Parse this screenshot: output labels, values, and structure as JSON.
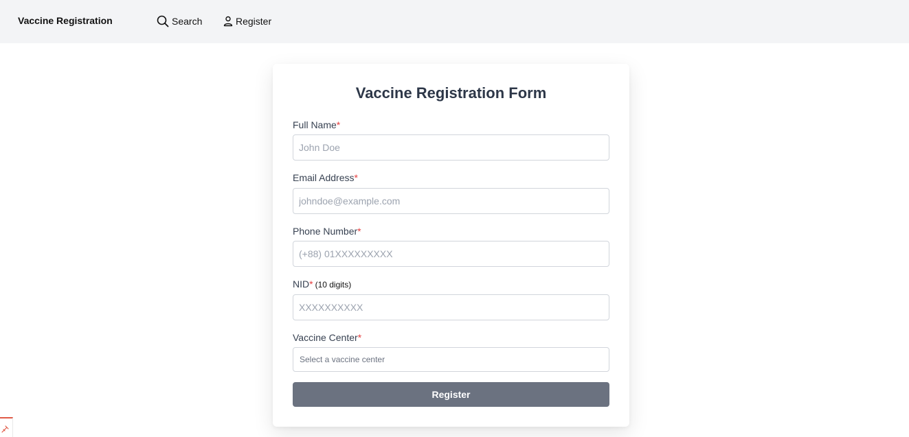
{
  "navbar": {
    "brand": "Vaccine Registration",
    "links": [
      {
        "label": "Search",
        "icon": "search-icon"
      },
      {
        "label": "Register",
        "icon": "user-icon"
      }
    ]
  },
  "form": {
    "title": "Vaccine Registration Form",
    "required_marker": "*",
    "fields": {
      "full_name": {
        "label": "Full Name",
        "placeholder": "John Doe",
        "value": ""
      },
      "email": {
        "label": "Email Address",
        "placeholder": "johndoe@example.com",
        "value": ""
      },
      "phone": {
        "label": "Phone Number",
        "placeholder": "(+88) 01XXXXXXXXX",
        "value": ""
      },
      "nid": {
        "label": "NID",
        "hint": "(10 digits)",
        "placeholder": "XXXXXXXXXX",
        "value": ""
      },
      "center": {
        "label": "Vaccine Center",
        "selected": "Select a vaccine center"
      }
    },
    "submit_label": "Register"
  },
  "colors": {
    "navbar_bg": "#f3f4f6",
    "required": "#e53e3e",
    "button_bg": "#6b7280",
    "corner_accent": "#e05a47"
  }
}
